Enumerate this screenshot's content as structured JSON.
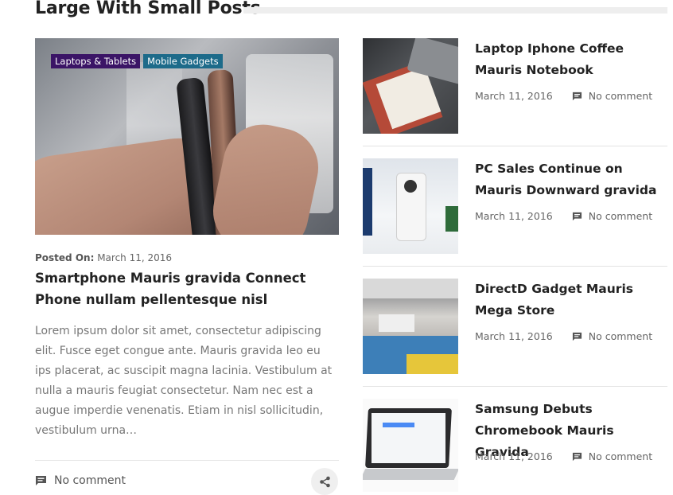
{
  "section": {
    "title": "Large With Small Posts"
  },
  "big_post": {
    "badges": [
      "Laptops & Tablets",
      "Mobile Gadgets"
    ],
    "posted_label": "Posted On:",
    "date": "March 11, 2016",
    "title": "Smartphone Mauris gravida Connect Phone nullam pellentesque nisl",
    "excerpt": "Lorem ipsum dolor sit amet, consectetur adipiscing elit.  Fusce eget congue ante.  Mauris gravida leo eu ips placerat, ac suscipit magna lacinia. Vestibulum at nulla a mauris feugiat consectetur. Nam nec est a augue imperdie venenatis. Etiam in nisl sollicitudin, vestibulum urna…",
    "comment": "No comment",
    "icons": {
      "comment": "comment-icon",
      "share": "share-icon"
    }
  },
  "small_posts": [
    {
      "title": "Laptop Iphone Coffee Mauris Notebook",
      "date": "March 11, 2016",
      "comment": "No comment"
    },
    {
      "title": "PC Sales Continue on Mauris Downward gravida",
      "date": "March 11, 2016",
      "comment": "No comment"
    },
    {
      "title": "DirectD Gadget Mauris Mega Store",
      "date": "March 11, 2016",
      "comment": "No comment"
    },
    {
      "title": "Samsung Debuts Chromebook Mauris Gravida",
      "date": "March 11, 2016",
      "comment": "No comment"
    }
  ],
  "colors": {
    "badge_1": "#3b1466",
    "badge_2": "#1d6b8a",
    "text": "#222222",
    "muted": "#777777"
  }
}
